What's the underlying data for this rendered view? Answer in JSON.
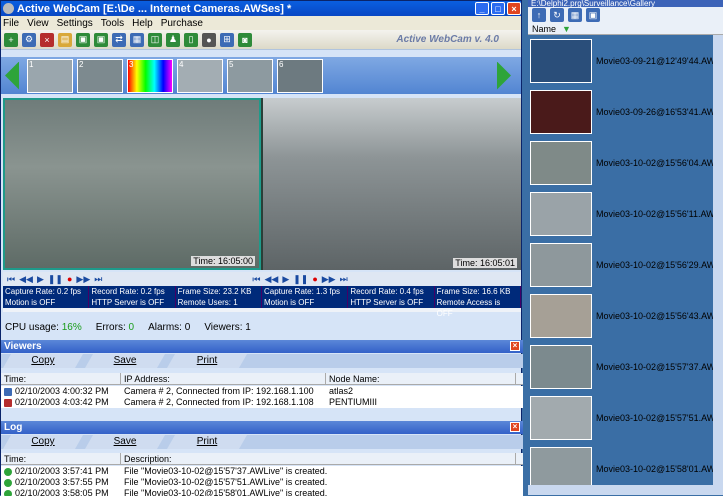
{
  "window": {
    "title": "Active WebCam [E:\\De ... Internet Cameras.AWSes] *",
    "brand": "Active WebCam v. 4.0"
  },
  "menu": [
    "File",
    "View",
    "Settings",
    "Tools",
    "Help",
    "Purchase"
  ],
  "thumbnails": [
    "1",
    "2",
    "3",
    "4",
    "5",
    "6"
  ],
  "videos": [
    {
      "time": "Time: 16:05:00"
    },
    {
      "time": "Time: 16:05:01"
    }
  ],
  "cam_stats": [
    [
      "Capture Rate: 0.2 fps",
      "Record Rate: 0.2 fps",
      "Frame Size: 23.2 KB",
      "Capture Rate: 1.3 fps",
      "Record Rate: 0.4 fps",
      "Frame Size: 16.6 KB"
    ],
    [
      "Motion is OFF",
      "HTTP Server is OFF",
      "Remote Users: 1",
      "Motion is OFF",
      "HTTP Server is OFF",
      "Remote Access is OFF"
    ]
  ],
  "status": {
    "cpu_label": "CPU usage:",
    "cpu": "16%",
    "errors_label": "Errors:",
    "errors": "0",
    "alarms_label": "Alarms:",
    "alarms": "0",
    "viewers_label": "Viewers:",
    "viewers": "1"
  },
  "viewers_panel": {
    "title": "Viewers",
    "actions": [
      "Copy",
      "Save",
      "Print"
    ],
    "columns": [
      "Time:",
      "IP Address:",
      "Node Name:"
    ],
    "rows": [
      [
        "02/10/2003 4:00:32 PM",
        "Camera # 2, Connected from IP: 192.168.1.100",
        "atlas2"
      ],
      [
        "02/10/2003 4:03:42 PM",
        "Camera # 2, Connected from IP: 192.168.1.108",
        "PENTIUMIII"
      ]
    ]
  },
  "log_panel": {
    "title": "Log",
    "actions": [
      "Copy",
      "Save",
      "Print"
    ],
    "columns": [
      "Time:",
      "Description:"
    ],
    "rows": [
      [
        "02/10/2003 3:57:41 PM",
        "File \"Movie03-10-02@15'57'37.AWLive\" is created."
      ],
      [
        "02/10/2003 3:57:55 PM",
        "File \"Movie03-10-02@15'57'51.AWLive\" is created."
      ],
      [
        "02/10/2003 3:58:05 PM",
        "File \"Movie03-10-02@15'58'01.AWLive\" is created."
      ]
    ]
  },
  "gallery": {
    "title": "E:\\Delphi2.prg\\Surveillance\\Gallery",
    "column": "Name",
    "items": [
      "Movie03-09-21@12'49'44.AW",
      "Movie03-09-26@16'53'41.AW",
      "Movie03-10-02@15'56'04.AW",
      "Movie03-10-02@15'56'11.AW",
      "Movie03-10-02@15'56'29.AW",
      "Movie03-10-02@15'56'43.AW",
      "Movie03-10-02@15'57'37.AW",
      "Movie03-10-02@15'57'51.AW",
      "Movie03-10-02@15'58'01.AW"
    ]
  },
  "colors": {
    "accent": "#0a5fe0",
    "panel": "#d6e4f7",
    "green": "#2ea43a"
  }
}
